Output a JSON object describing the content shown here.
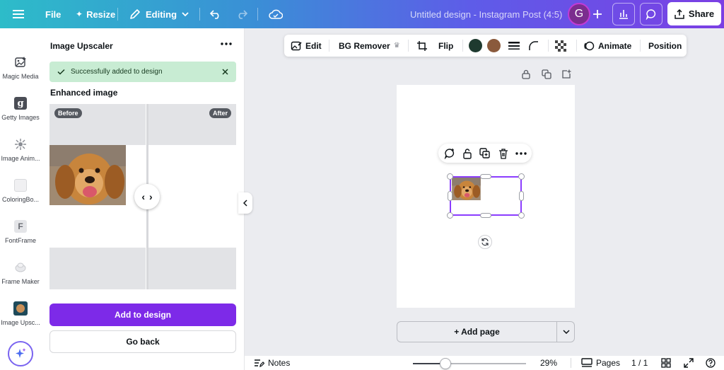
{
  "topbar": {
    "file_label": "File",
    "resize_label": "Resize",
    "editing_label": "Editing",
    "doc_title": "Untitled design - Instagram Post (4:5)",
    "avatar_initial": "G",
    "share_label": "Share"
  },
  "rail": {
    "items": [
      {
        "label": "Magic Media",
        "icon": "magic-media-icon"
      },
      {
        "label": "Getty Images",
        "icon": "getty-icon"
      },
      {
        "label": "Image Anim...",
        "icon": "image-animate-icon"
      },
      {
        "label": "ColoringBo...",
        "icon": "coloring-book-icon"
      },
      {
        "label": "FontFrame",
        "icon": "fontframe-icon"
      },
      {
        "label": "Frame Maker",
        "icon": "frame-maker-icon"
      },
      {
        "label": "Image Upsc...",
        "icon": "image-upscaler-icon"
      }
    ]
  },
  "panel": {
    "title": "Image Upscaler",
    "toast": "Successfully added to design",
    "enhanced_label": "Enhanced image",
    "before_label": "Before",
    "after_label": "After",
    "add_label": "Add to design",
    "back_label": "Go back"
  },
  "context_toolbar": {
    "edit_label": "Edit",
    "bg_remover_label": "BG Remover",
    "flip_label": "Flip",
    "animate_label": "Animate",
    "position_label": "Position",
    "swatches": [
      "#1e3a2f",
      "#8a5a3c"
    ]
  },
  "canvas": {
    "add_page_label": "+ Add page"
  },
  "bottom": {
    "notes_label": "Notes",
    "zoom_value": "29%",
    "zoom_fraction": 0.29,
    "pages_label": "Pages",
    "page_count": "1 / 1"
  }
}
